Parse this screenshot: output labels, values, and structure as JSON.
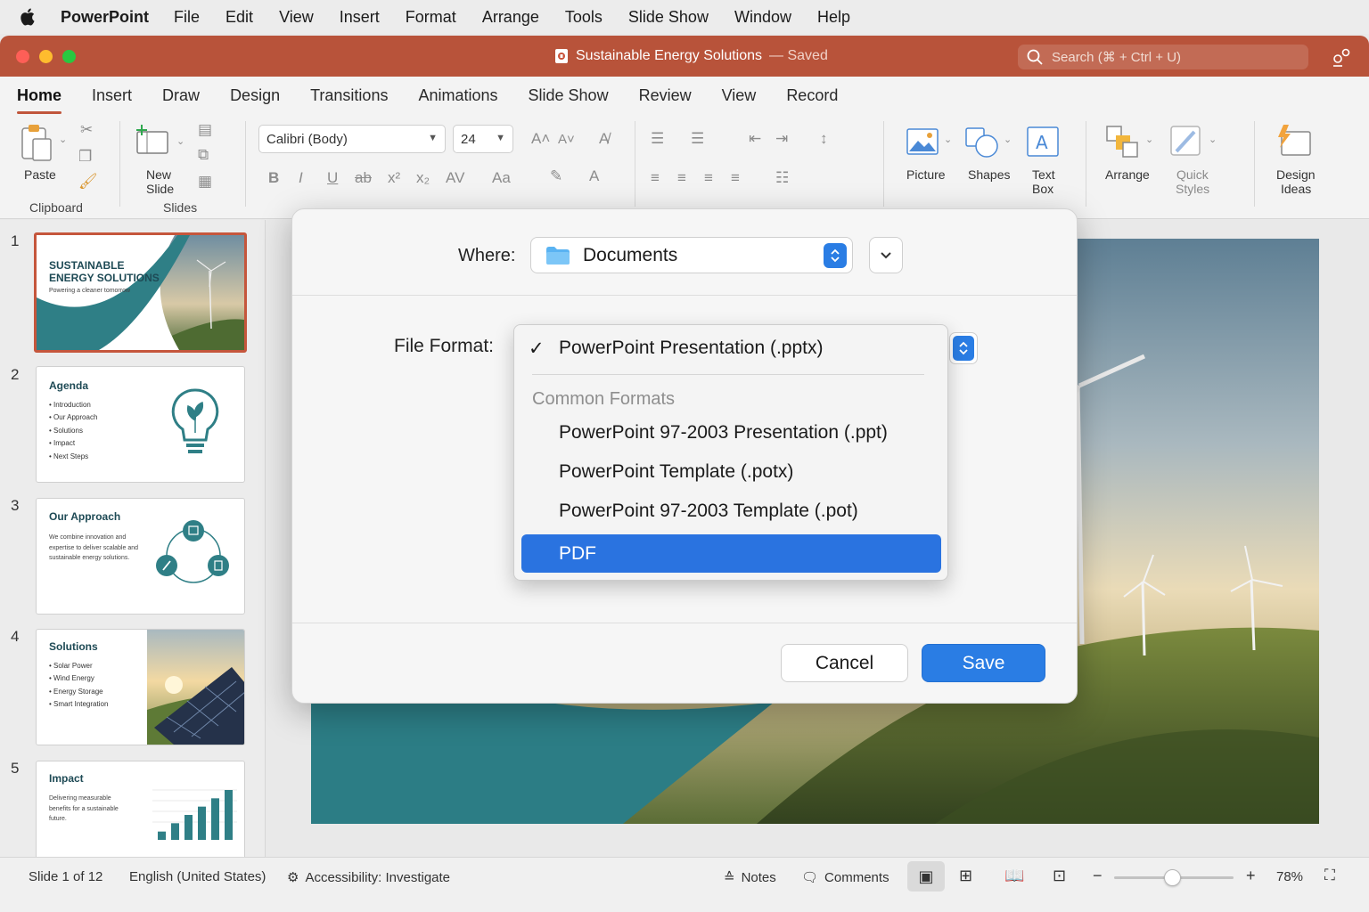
{
  "menubar": {
    "app": "PowerPoint",
    "items": [
      "File",
      "Edit",
      "View",
      "Insert",
      "Format",
      "Arrange",
      "Tools",
      "Slide Show",
      "Window",
      "Help"
    ]
  },
  "window": {
    "title": "Sustainable Energy Solutions",
    "status": "— Saved",
    "search_placeholder": "Search (⌘ + Ctrl + U)",
    "accent": "#b8533a"
  },
  "tabs": [
    "Home",
    "Insert",
    "Draw",
    "Design",
    "Transitions",
    "Animations",
    "Slide Show",
    "Review",
    "View",
    "Record"
  ],
  "ribbon": {
    "paste": "Paste",
    "new_slide_1": "New",
    "new_slide_2": "Slide",
    "clipboard": "Clipboard",
    "slides": "Slides",
    "font": "Calibri (Body)",
    "size": "24",
    "picture": "Picture",
    "shapes": "Shapes",
    "textbox_1": "Text",
    "textbox_2": "Box",
    "arrange": "Arrange",
    "quick_1": "Quick",
    "quick_2": "Styles",
    "design_1": "Design",
    "design_2": "Ideas"
  },
  "thumbnails": [
    {
      "num": "1",
      "title_1": "SUSTAINABLE",
      "title_2": "ENERGY SOLUTIONS",
      "sub": "Powering a cleaner tomorrow"
    },
    {
      "num": "2",
      "title": "Agenda",
      "bullets": [
        "Introduction",
        "Our Approach",
        "Solutions",
        "Impact",
        "Next Steps"
      ]
    },
    {
      "num": "3",
      "title": "Our Approach",
      "text": "We combine innovation and expertise to deliver scalable and sustainable energy solutions."
    },
    {
      "num": "4",
      "title": "Solutions",
      "bullets": [
        "Solar Power",
        "Wind Energy",
        "Energy Storage",
        "Smart Integration"
      ]
    },
    {
      "num": "5",
      "title": "Impact",
      "text": "Delivering measurable benefits for a sustainable future.",
      "bars": [
        1,
        2,
        3,
        4,
        5,
        6
      ]
    }
  ],
  "dialog": {
    "where_label": "Where:",
    "where_value": "Documents",
    "format_label": "File Format:",
    "cancel": "Cancel",
    "save": "Save",
    "menu": {
      "checked": "PowerPoint Presentation (.pptx)",
      "section": "Common Formats",
      "items": [
        "PowerPoint 97-2003 Presentation (.ppt)",
        "PowerPoint Template (.potx)",
        "PowerPoint 97-2003 Template (.pot)"
      ],
      "highlighted": "PDF"
    }
  },
  "statusbar": {
    "slide": "Slide 1 of 12",
    "language": "English (United States)",
    "accessibility": "Accessibility: Investigate",
    "notes": "Notes",
    "comments": "Comments",
    "zoom": "78%",
    "zoom_level": 0.49
  }
}
